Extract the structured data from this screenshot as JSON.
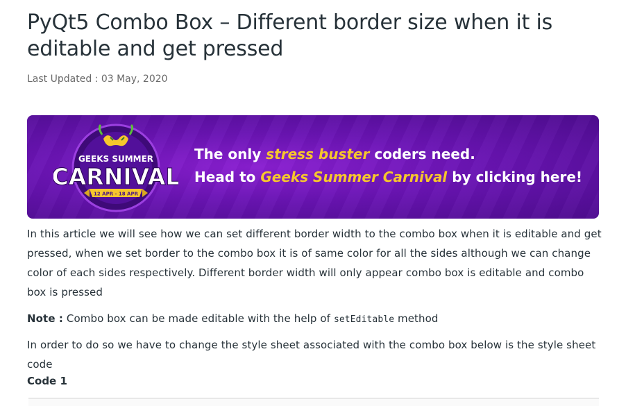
{
  "article": {
    "title": "PyQt5 Combo Box – Different border size when it is editable and get pressed",
    "last_updated": "Last Updated : 03 May, 2020"
  },
  "banner": {
    "badge_line1": "GEEKS SUMMER",
    "badge_line2": "CARNIVAL",
    "badge_dates": "12 APR - 18 APR",
    "line1_pre": "The only ",
    "line1_accent": "stress buster",
    "line1_post": " coders need.",
    "line2_pre": "Head to ",
    "line2_accent": "Geeks Summer Carnival",
    "line2_post": " by clicking here!",
    "colors": {
      "background": "#6a14b4",
      "accent": "#f7c72c",
      "text": "#ffffff"
    }
  },
  "body": {
    "para1": "In this article we will see how we can set different border width to the combo box when it is editable and get pressed, when we set border to the combo box it is of same color for all the sides although we can change color of each sides respectively. Different border width will only appear combo box is editable and combo box is pressed",
    "note_label": "Note :",
    "note_text": " Combo box can be made editable with the help of ",
    "note_code": "setEditable",
    "note_suffix": " method",
    "para3": "In order to do so we have to change the style sheet associated with the combo box below is the style sheet code",
    "code_label": "Code 1"
  }
}
